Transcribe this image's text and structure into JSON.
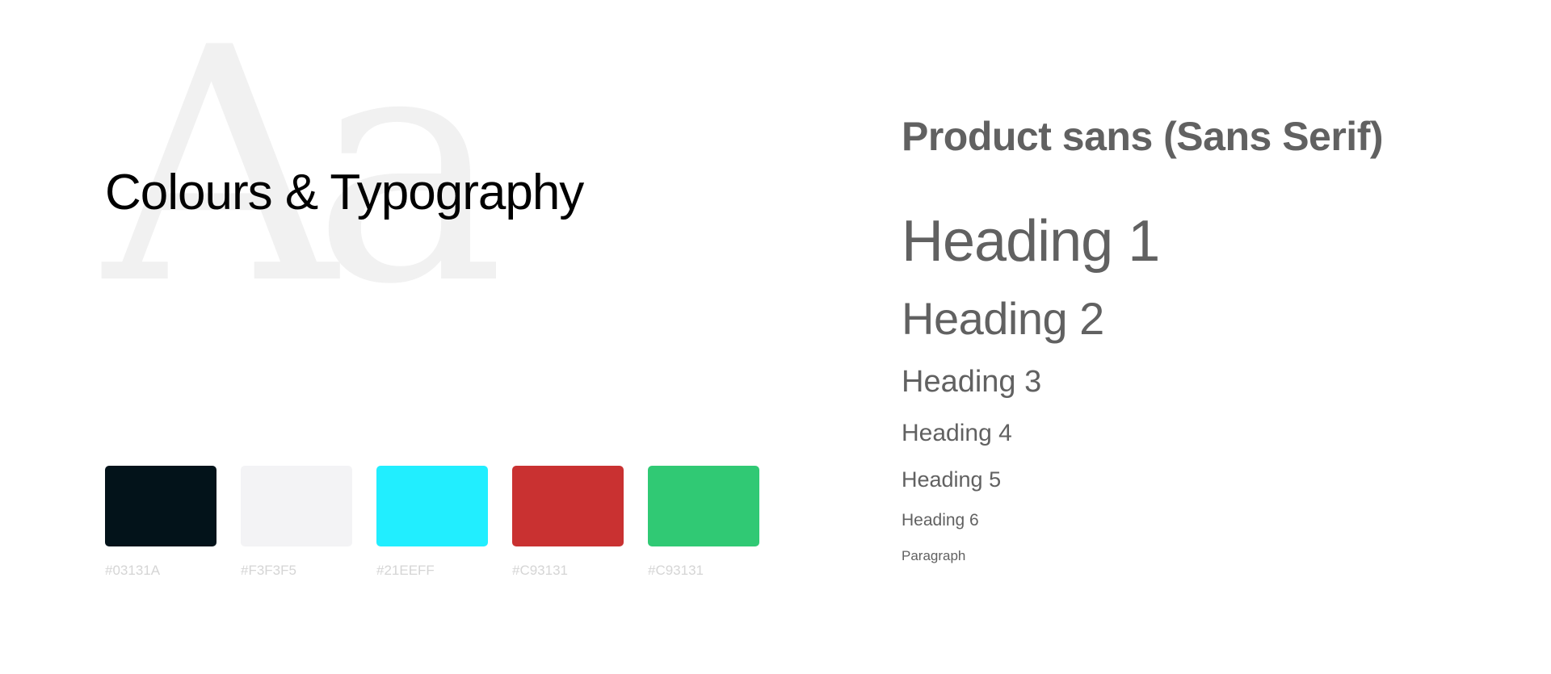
{
  "background": {
    "glyphs": "Aa"
  },
  "title": "Colours & Typography",
  "swatches": [
    {
      "color": "#03131A",
      "label": "#03131A"
    },
    {
      "color": "#F3F3F5",
      "label": "#F3F3F5"
    },
    {
      "color": "#21EEFF",
      "label": "#21EEFF"
    },
    {
      "color": "#C93131",
      "label": "#C93131"
    },
    {
      "color": "#30C974",
      "label": "#C93131"
    }
  ],
  "typography": {
    "font_name": "Product sans (Sans Serif)",
    "heading_1": "Heading 1",
    "heading_2": "Heading 2",
    "heading_3": "Heading 3",
    "heading_4": "Heading 4",
    "heading_5": "Heading 5",
    "heading_6": "Heading 6",
    "paragraph": "Paragraph"
  },
  "colors": {
    "title_text": "#000000",
    "type_text": "#616161",
    "swatch_label": "#d5d5d5",
    "watermark": "#f1f1f1"
  }
}
